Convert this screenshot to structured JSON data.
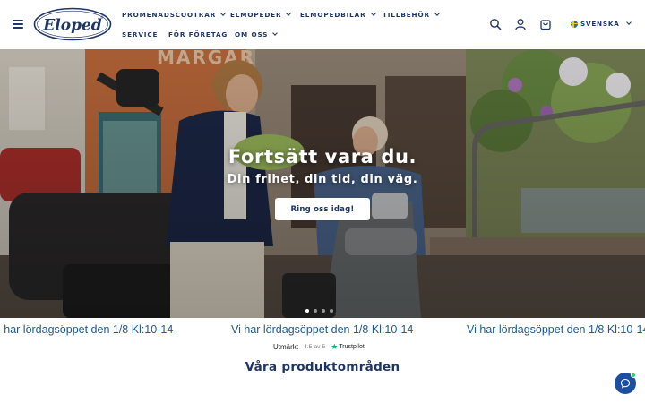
{
  "brand": {
    "logo_text": "Eloped",
    "primary_color": "#1d3567",
    "ticker_color": "#1d5a9a"
  },
  "nav": {
    "items": [
      {
        "label": "PROMENADSCOOTRAR",
        "has_dropdown": true
      },
      {
        "label": "ELMOPEDER",
        "has_dropdown": true
      },
      {
        "label": "ELMOPEDBILAR",
        "has_dropdown": true
      },
      {
        "label": "TILLBEHÖR",
        "has_dropdown": true
      },
      {
        "label": "SERVICE",
        "has_dropdown": false
      },
      {
        "label": "FÖR FÖRETAG",
        "has_dropdown": false
      },
      {
        "label": "OM OSS",
        "has_dropdown": true
      }
    ]
  },
  "header_icons": [
    "search-icon",
    "account-icon",
    "cart-icon"
  ],
  "language": {
    "label": "SVENSKA",
    "flag": "sweden-flag-icon"
  },
  "hero": {
    "title": "Fortsätt vara du.",
    "subtitle": "Din frihet, din tid, din väg.",
    "cta_label": "Ring oss idag!",
    "slides": 4,
    "active_slide": 0
  },
  "ticker": {
    "text": "Vi har lördagsöppet den 1/8 Kl:10-14",
    "partial_text": "i har lördagsöppet den 1/8 Kl:10-14"
  },
  "trustpilot": {
    "label": "Utmärkt",
    "score": "4.5 av 5",
    "brand": "Trustpilot"
  },
  "section": {
    "title": "Våra produktområden"
  },
  "chat": {
    "icon": "chat-icon"
  }
}
